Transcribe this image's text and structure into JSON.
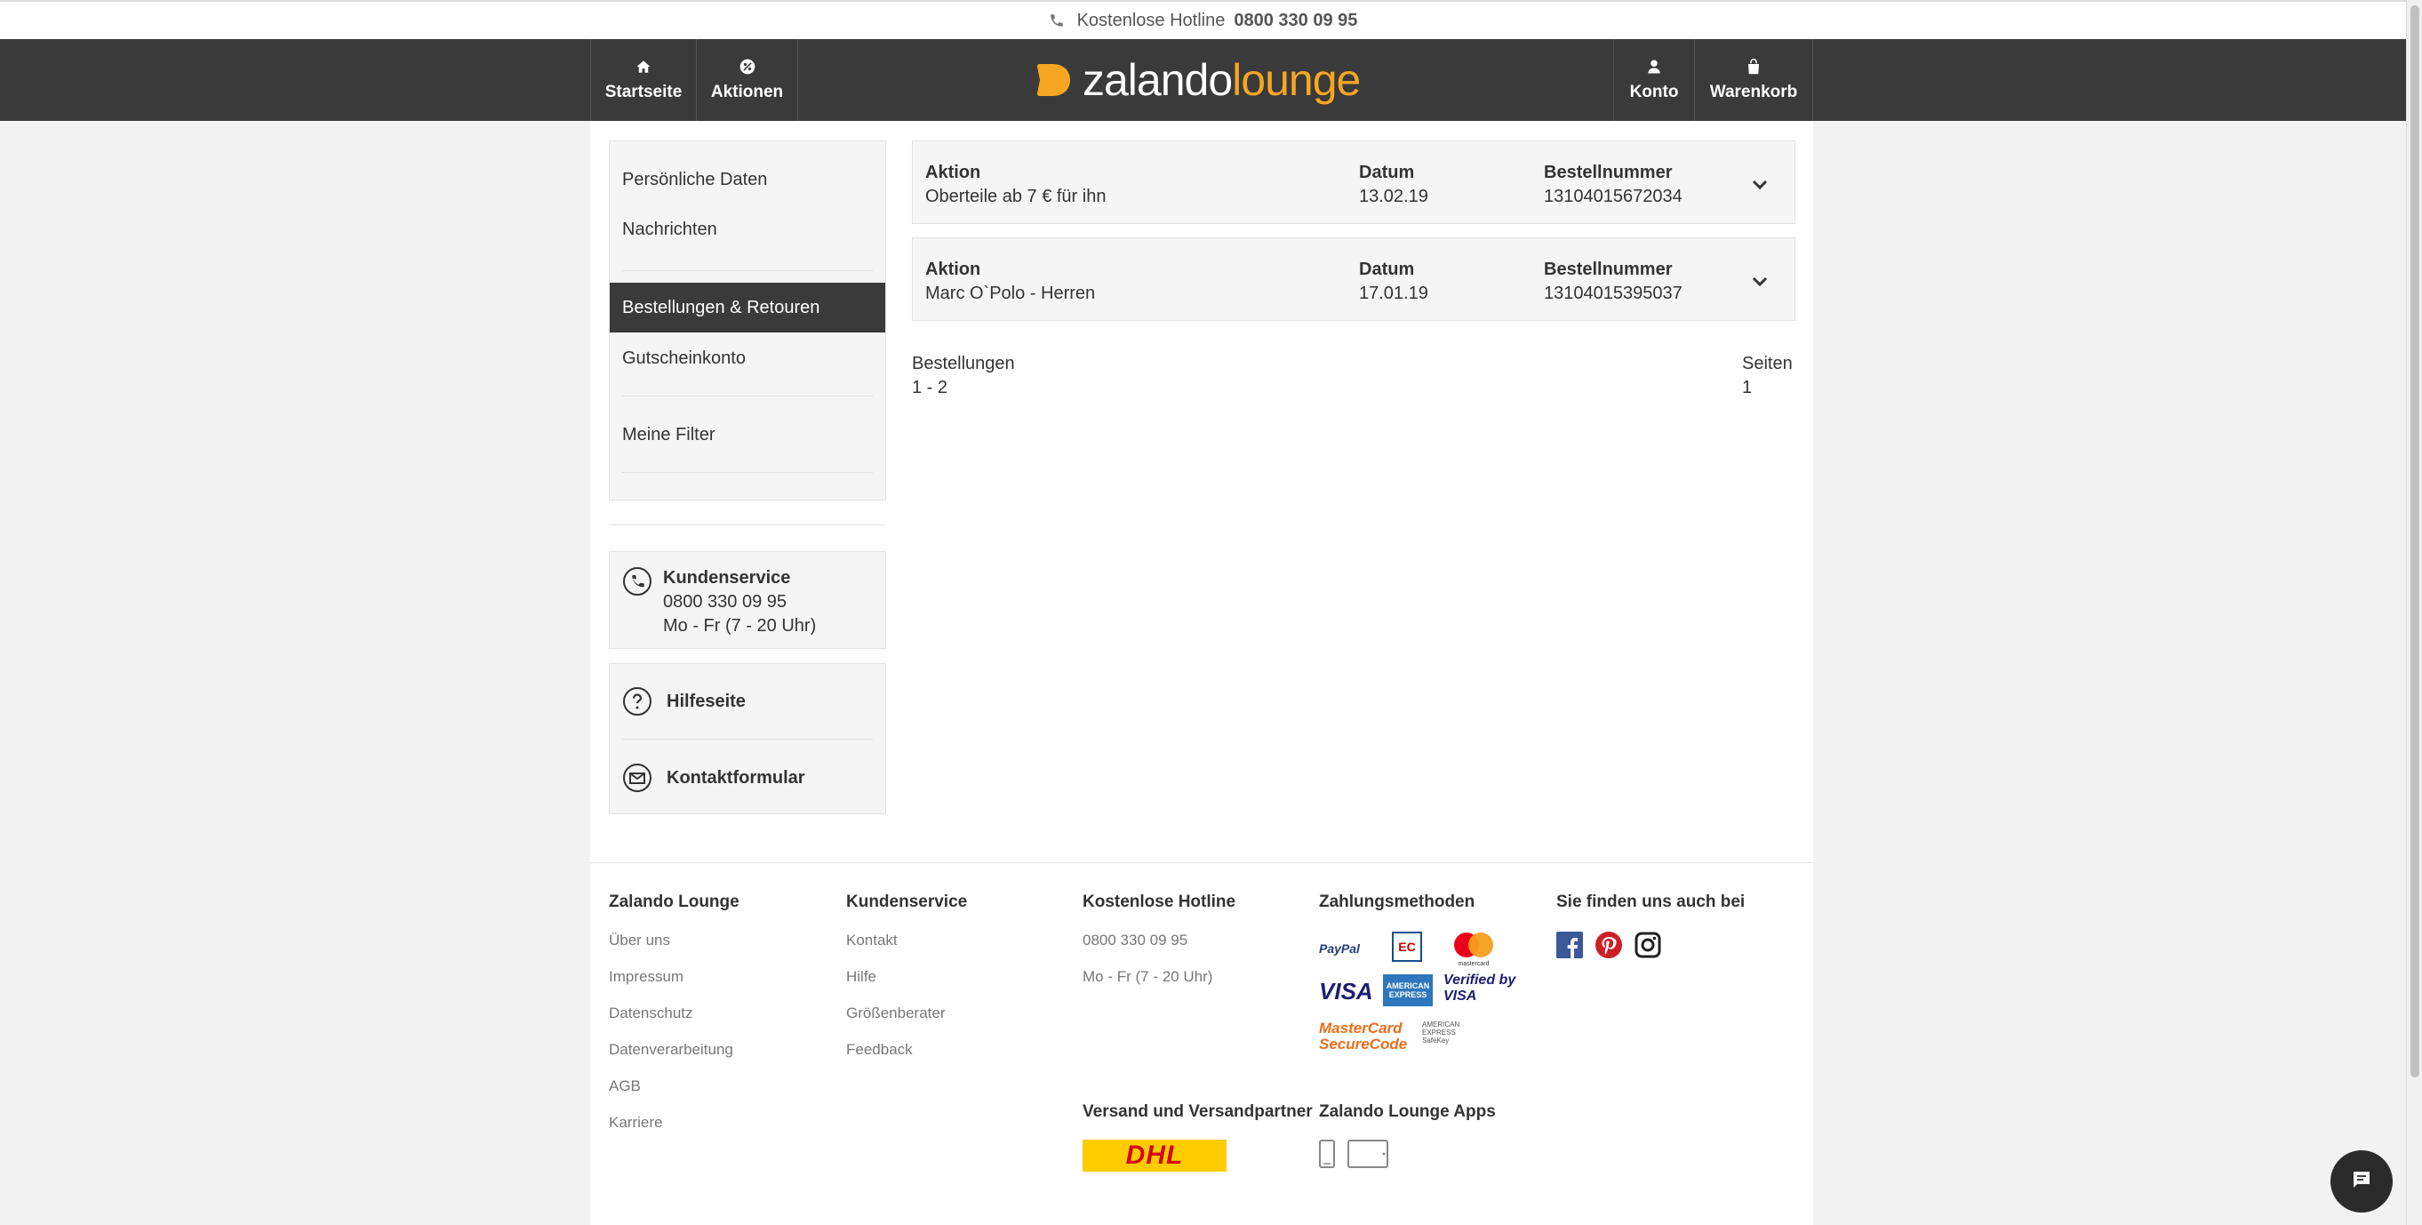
{
  "hotline": {
    "label": "Kostenlose Hotline",
    "number": "0800 330 09 95"
  },
  "header": {
    "nav_left": [
      {
        "label": "Startseite",
        "icon": "home-icon"
      },
      {
        "label": "Aktionen",
        "icon": "sale-icon"
      }
    ],
    "logo": {
      "part1": "zalando",
      "part2": "lounge"
    },
    "nav_right": [
      {
        "label": "Konto",
        "icon": "user-icon"
      },
      {
        "label": "Warenkorb",
        "icon": "bag-icon"
      }
    ]
  },
  "sidebar": {
    "items": [
      {
        "label": "Persönliche Daten"
      },
      {
        "label": "Nachrichten"
      },
      {
        "label": "Bestellungen & Retouren",
        "active": true
      },
      {
        "label": "Gutscheinkonto"
      },
      {
        "label": "Meine Filter"
      }
    ]
  },
  "customer_service": {
    "title": "Kundenservice",
    "phone": "0800 330 09 95",
    "hours": "Mo - Fr (7 - 20 Uhr)"
  },
  "help": {
    "items": [
      {
        "label": "Hilfeseite",
        "icon": "question-icon"
      },
      {
        "label": "Kontaktformular",
        "icon": "mail-icon"
      }
    ]
  },
  "orders": {
    "columns": {
      "action": "Aktion",
      "date": "Datum",
      "number": "Bestellnummer"
    },
    "rows": [
      {
        "action": "Oberteile ab 7 € für ihn",
        "date": "13.02.19",
        "number": "13104015672034"
      },
      {
        "action": "Marc O`Polo - Herren",
        "date": "17.01.19",
        "number": "13104015395037"
      }
    ],
    "summary": {
      "orders_label": "Bestellungen",
      "orders_range": "1 - 2",
      "pages_label": "Seiten",
      "pages_value": "1"
    }
  },
  "footer": {
    "zalando": {
      "title": "Zalando Lounge",
      "links": [
        "Über uns",
        "Impressum",
        "Datenschutz",
        "Datenverarbeitung",
        "AGB",
        "Karriere"
      ]
    },
    "service": {
      "title": "Kundenservice",
      "links": [
        "Kontakt",
        "Hilfe",
        "Größenberater",
        "Feedback"
      ]
    },
    "hotline": {
      "title": "Kostenlose Hotline",
      "lines": [
        "0800 330 09 95",
        "Mo - Fr (7 - 20 Uhr)"
      ]
    },
    "payments": {
      "title": "Zahlungsmethoden",
      "methods": [
        "PayPal",
        "EC",
        "mastercard",
        "VISA",
        "AMERICAN EXPRESS",
        "Verified by VISA",
        "MasterCard SecureCode",
        "AMERICAN EXPRESS SafeKey"
      ]
    },
    "social": {
      "title": "Sie finden uns auch bei",
      "icons": [
        "facebook-icon",
        "pinterest-icon",
        "instagram-icon"
      ]
    },
    "shipping": {
      "title": "Versand und Versandpartner",
      "partner": "DHL"
    },
    "apps": {
      "title": "Zalando Lounge Apps"
    }
  },
  "colors": {
    "accent": "#f5a623",
    "header_bg": "#3a3a3a",
    "dhl_yellow": "#ffcc00",
    "dhl_red": "#d40511"
  }
}
